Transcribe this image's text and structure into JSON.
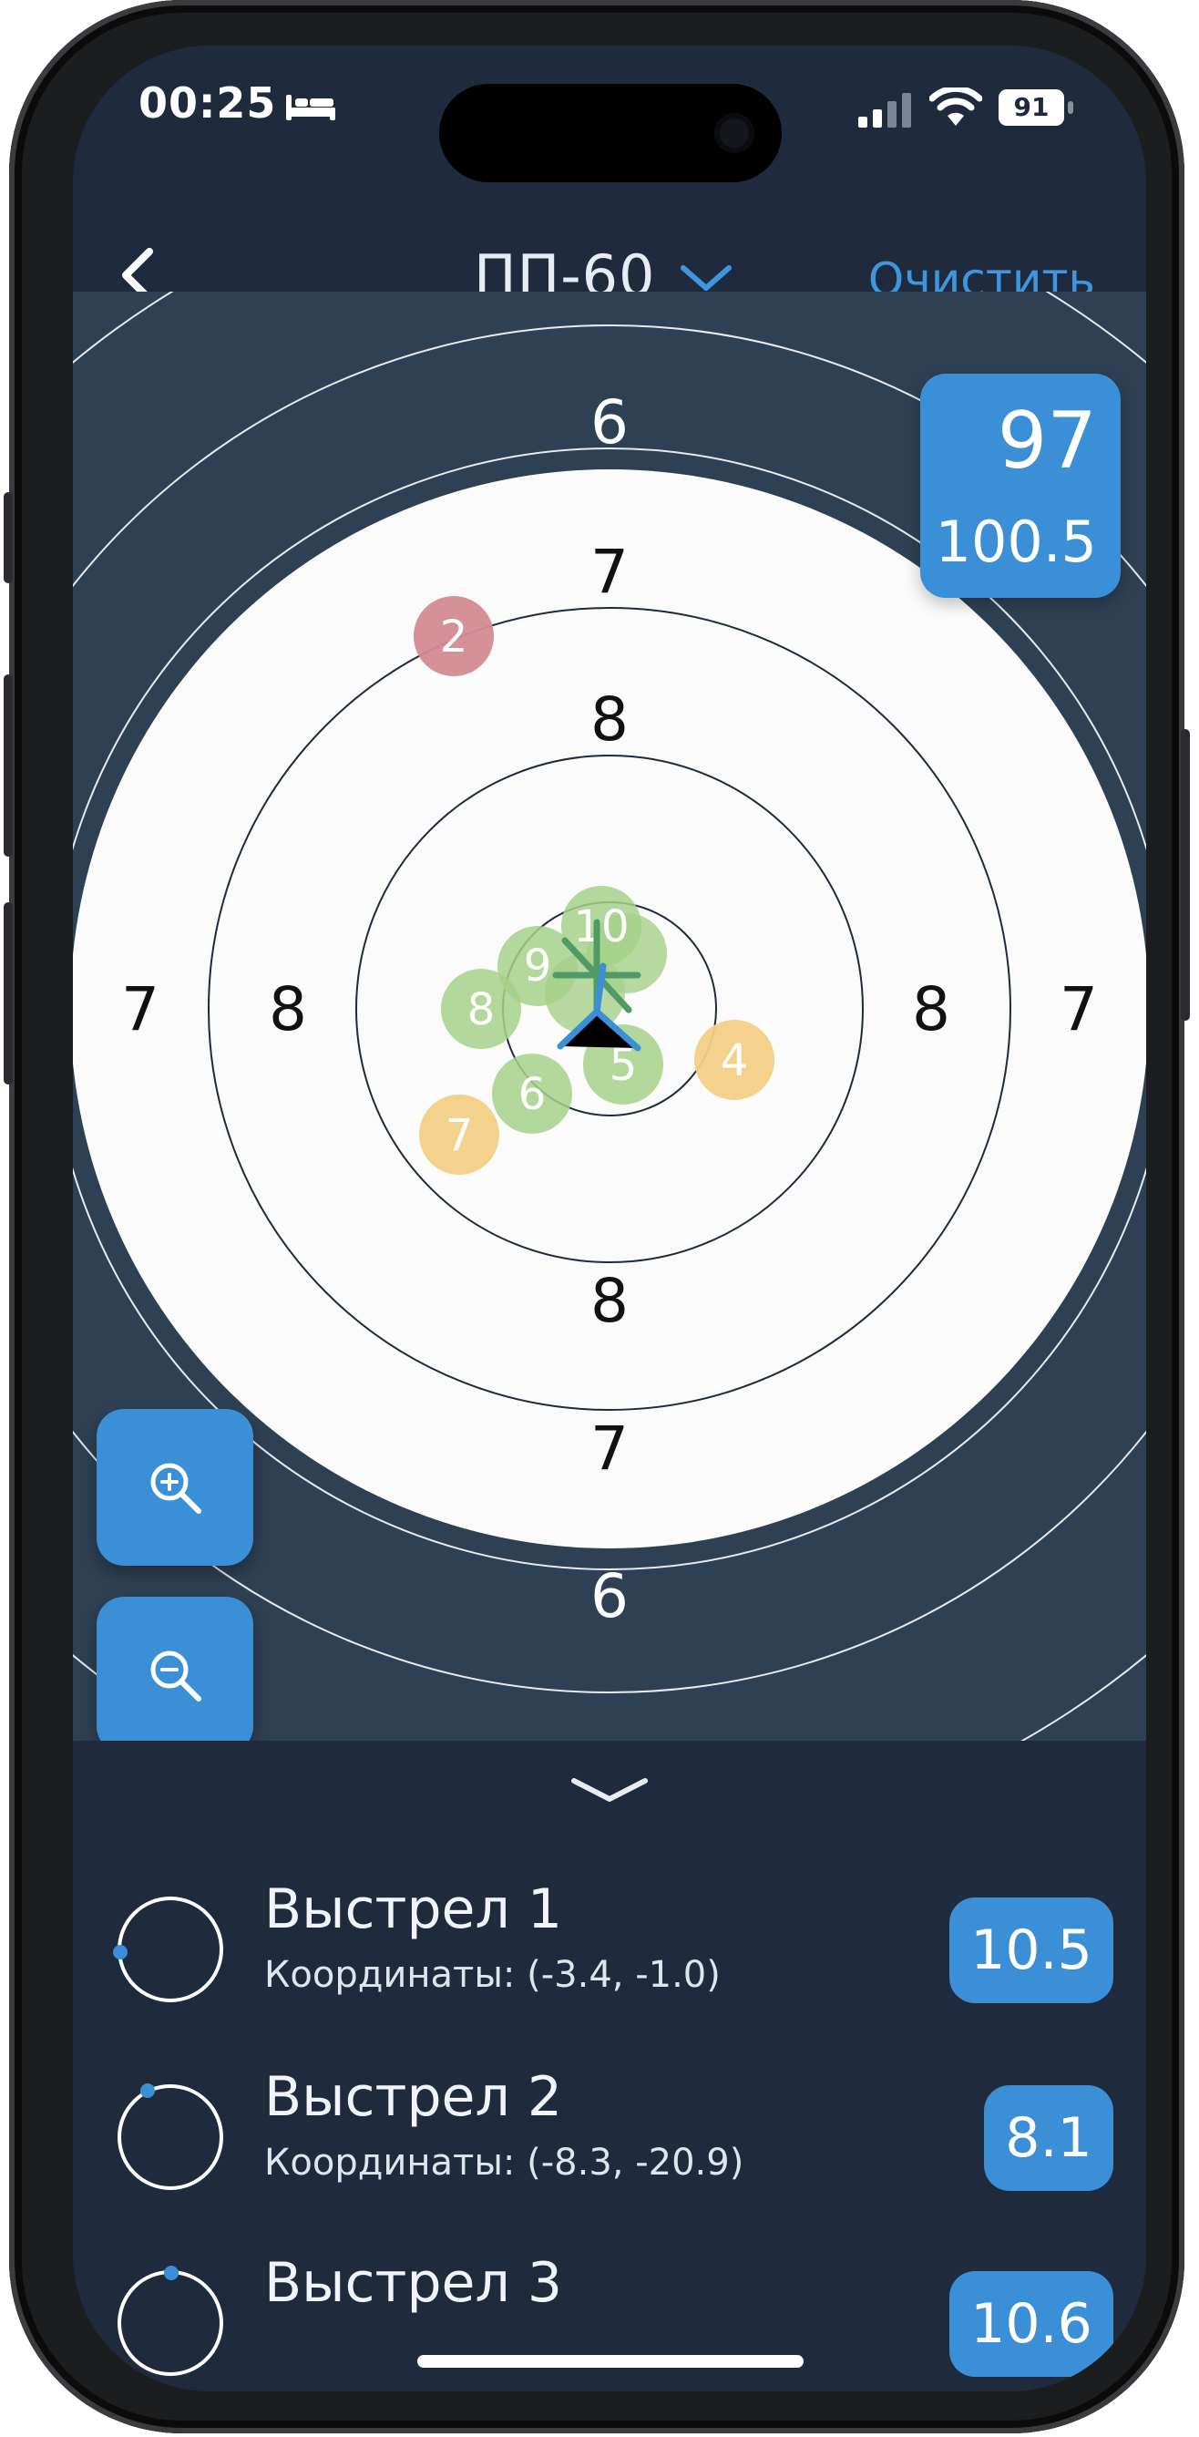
{
  "status_bar": {
    "time": "00:25",
    "battery": "91",
    "icons": [
      "bed-icon",
      "signal-icon",
      "wifi-icon",
      "battery-icon"
    ]
  },
  "nav": {
    "back_icon": "chevron-left-icon",
    "title": "ПП-60",
    "title_icon": "chevron-down-icon",
    "clear_label": "Очистить"
  },
  "target": {
    "ring_labels": {
      "top": [
        "6",
        "7",
        "8"
      ],
      "left": [
        "7",
        "8"
      ],
      "right": [
        "8",
        "7"
      ],
      "bottom": [
        "8",
        "7",
        "6"
      ]
    },
    "hits": [
      {
        "label": "2",
        "color": "#d48a92"
      },
      {
        "label": "10",
        "color": "#a6d189"
      },
      {
        "label": "9",
        "color": "#a6d189"
      },
      {
        "label": "8",
        "color": "#a6d189"
      },
      {
        "label": "5",
        "color": "#a6d189"
      },
      {
        "label": "6",
        "color": "#a6d189"
      },
      {
        "label": "4",
        "color": "#f3cf87"
      },
      {
        "label": "7",
        "color": "#f3cf87"
      }
    ]
  },
  "score": {
    "total": "97",
    "decimal": "100.5"
  },
  "zoom": {
    "zoom_in_icon": "zoom-in-icon",
    "zoom_out_icon": "zoom-out-icon"
  },
  "sheet": {
    "handle_icon": "chevron-down-icon",
    "shots": [
      {
        "title": "Выстрел 1",
        "coords": "Координаты: (-3.4, -1.0)",
        "score": "10.5"
      },
      {
        "title": "Выстрел 2",
        "coords": "Координаты: (-8.3, -20.9)",
        "score": "8.1"
      },
      {
        "title": "Выстрел 3",
        "coords": "",
        "score": "10.6"
      }
    ]
  },
  "colors": {
    "background": "#1f2b3c",
    "target_background": "#2e4053",
    "accent": "#3a8fd7",
    "link": "#3d97e0",
    "hit_green": "#a6d189",
    "hit_yellow": "#f3cf87",
    "hit_red": "#d48a92"
  }
}
